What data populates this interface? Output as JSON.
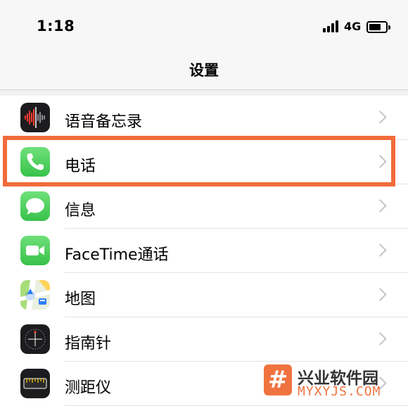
{
  "status_bar": {
    "time": "1:18",
    "network": "4G",
    "signal_icon": "signal-bars-icon",
    "battery_icon": "battery-icon"
  },
  "nav": {
    "title": "设置"
  },
  "settings_items": [
    {
      "label": "语音备忘录",
      "icon": "voice-memos-icon",
      "icon_color": "#1c1c1e"
    },
    {
      "label": "电话",
      "icon": "phone-icon",
      "icon_color": "#4cd964",
      "highlighted": true
    },
    {
      "label": "信息",
      "icon": "messages-icon",
      "icon_color": "#4cd964"
    },
    {
      "label": "FaceTime通话",
      "icon": "facetime-icon",
      "icon_color": "#4cd964"
    },
    {
      "label": "地图",
      "icon": "maps-icon",
      "icon_color": "#7fc9ff"
    },
    {
      "label": "指南针",
      "icon": "compass-icon",
      "icon_color": "#1c1c1e"
    },
    {
      "label": "测距仪",
      "icon": "measure-icon",
      "icon_color": "#1c1c1e"
    }
  ],
  "highlight_color": "#f26b3a",
  "watermark": {
    "badge": "#",
    "title": "兴业软件园",
    "url": "MYXYJS.COM",
    "color": "#f0733f"
  }
}
